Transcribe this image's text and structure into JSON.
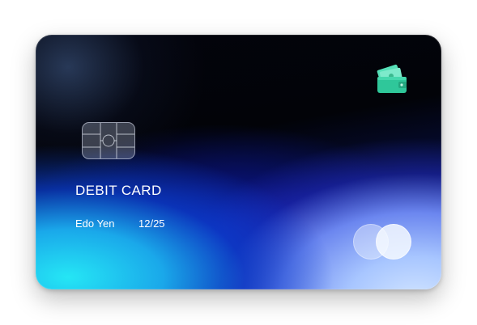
{
  "card": {
    "label": "DEBIT CARD",
    "holder_name": "Edo Yen",
    "expiry": "12/25"
  },
  "icons": {
    "wallet": "wallet-icon",
    "chip": "chip-icon",
    "brand": "card-brand-logo"
  },
  "colors": {
    "background": "#ffffff",
    "text": "#ffffff",
    "card_dark": "#020308",
    "card_cyan": "#25e6f5",
    "card_blue": "#1a2aa8",
    "card_light": "#d2e5ff",
    "wallet_green": "#3fd3a0"
  }
}
